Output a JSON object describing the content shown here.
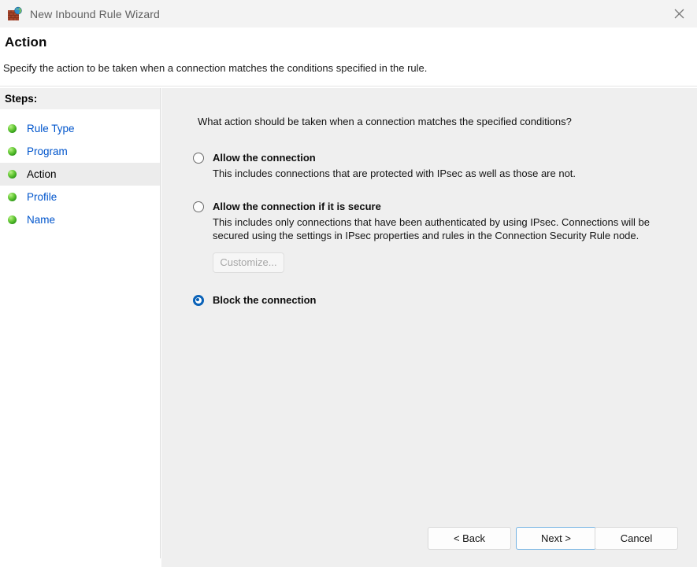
{
  "window": {
    "title": "New Inbound Rule Wizard",
    "icon": "firewall-globe-icon",
    "close_label": "×"
  },
  "header": {
    "title": "Action",
    "subtitle": "Specify the action to be taken when a connection matches the conditions specified in the rule."
  },
  "sidebar": {
    "header_label": "Steps:",
    "items": [
      {
        "label": "Rule Type",
        "active": false
      },
      {
        "label": "Program",
        "active": false
      },
      {
        "label": "Action",
        "active": true
      },
      {
        "label": "Profile",
        "active": false
      },
      {
        "label": "Name",
        "active": false
      }
    ]
  },
  "main": {
    "question": "What action should be taken when a connection matches the specified conditions?",
    "options": [
      {
        "title": "Allow the connection",
        "description": "This includes connections that are protected with IPsec as well as those are not.",
        "selected": false
      },
      {
        "title": "Allow the connection if it is secure",
        "description": "This includes only connections that have been authenticated by using IPsec.  Connections will be secured using the settings in IPsec properties and rules in the Connection Security Rule node.",
        "selected": false,
        "customize_label": "Customize...",
        "customize_disabled": true
      },
      {
        "title": "Block the connection",
        "description": "",
        "selected": true
      }
    ]
  },
  "footer": {
    "back_label": "< Back",
    "next_label": "Next >",
    "cancel_label": "Cancel"
  },
  "colors": {
    "titlebar_bg": "#f3f3f3",
    "content_bg": "#efefef",
    "link_text": "#0055cc",
    "accent_radio": "#0a62b8",
    "focus_border": "#74b3e3",
    "step_bullet": "#4caf27"
  }
}
